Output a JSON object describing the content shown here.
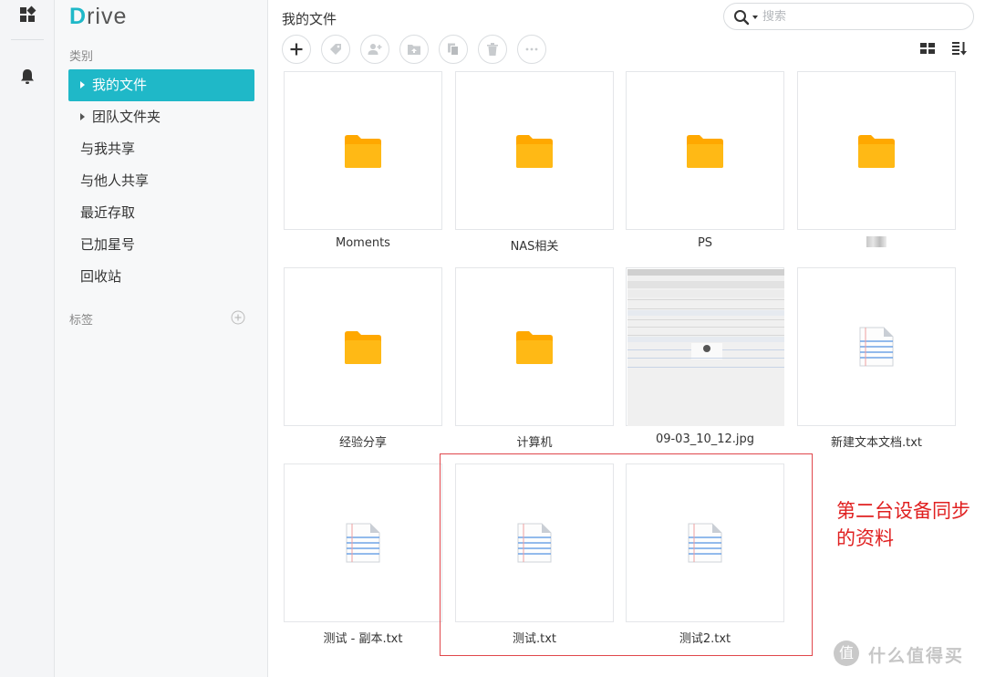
{
  "app": {
    "logo_first": "D",
    "logo_rest": "rive"
  },
  "sidebar": {
    "category_label": "类别",
    "items": [
      {
        "label": "我的文件",
        "active": true,
        "expandable": true
      },
      {
        "label": "团队文件夹",
        "active": false,
        "expandable": true
      },
      {
        "label": "与我共享",
        "active": false
      },
      {
        "label": "与他人共享",
        "active": false
      },
      {
        "label": "最近存取",
        "active": false
      },
      {
        "label": "已加星号",
        "active": false
      },
      {
        "label": "回收站",
        "active": false
      }
    ],
    "tags_label": "标签"
  },
  "header": {
    "title": "我的文件"
  },
  "search": {
    "placeholder": "搜索",
    "value": ""
  },
  "toolbar": [
    "new-icon",
    "tag-icon",
    "share-user-icon",
    "upload-folder-icon",
    "copy-icon",
    "delete-icon",
    "more-icon"
  ],
  "files": [
    {
      "name": "Moments",
      "type": "folder"
    },
    {
      "name": "NAS相关",
      "type": "folder"
    },
    {
      "name": "PS",
      "type": "folder"
    },
    {
      "name": "",
      "type": "folder",
      "blurred": true
    },
    {
      "name": "经验分享",
      "type": "folder"
    },
    {
      "name": "计算机",
      "type": "folder"
    },
    {
      "name": "09-03_10_12.jpg",
      "type": "image"
    },
    {
      "name": "新建文本文档.txt",
      "type": "text"
    },
    {
      "name": "测试 - 副本.txt",
      "type": "text"
    },
    {
      "name": "测试.txt",
      "type": "text"
    },
    {
      "name": "测试2.txt",
      "type": "text"
    }
  ],
  "annotation": {
    "line1": "第二台设备同步",
    "line2": "的资料"
  },
  "watermark": {
    "symbol": "值",
    "text": "什么值得买"
  },
  "colors": {
    "accent": "#1fb8c8",
    "folder": "#ffb000",
    "annotation": "#e02020"
  }
}
